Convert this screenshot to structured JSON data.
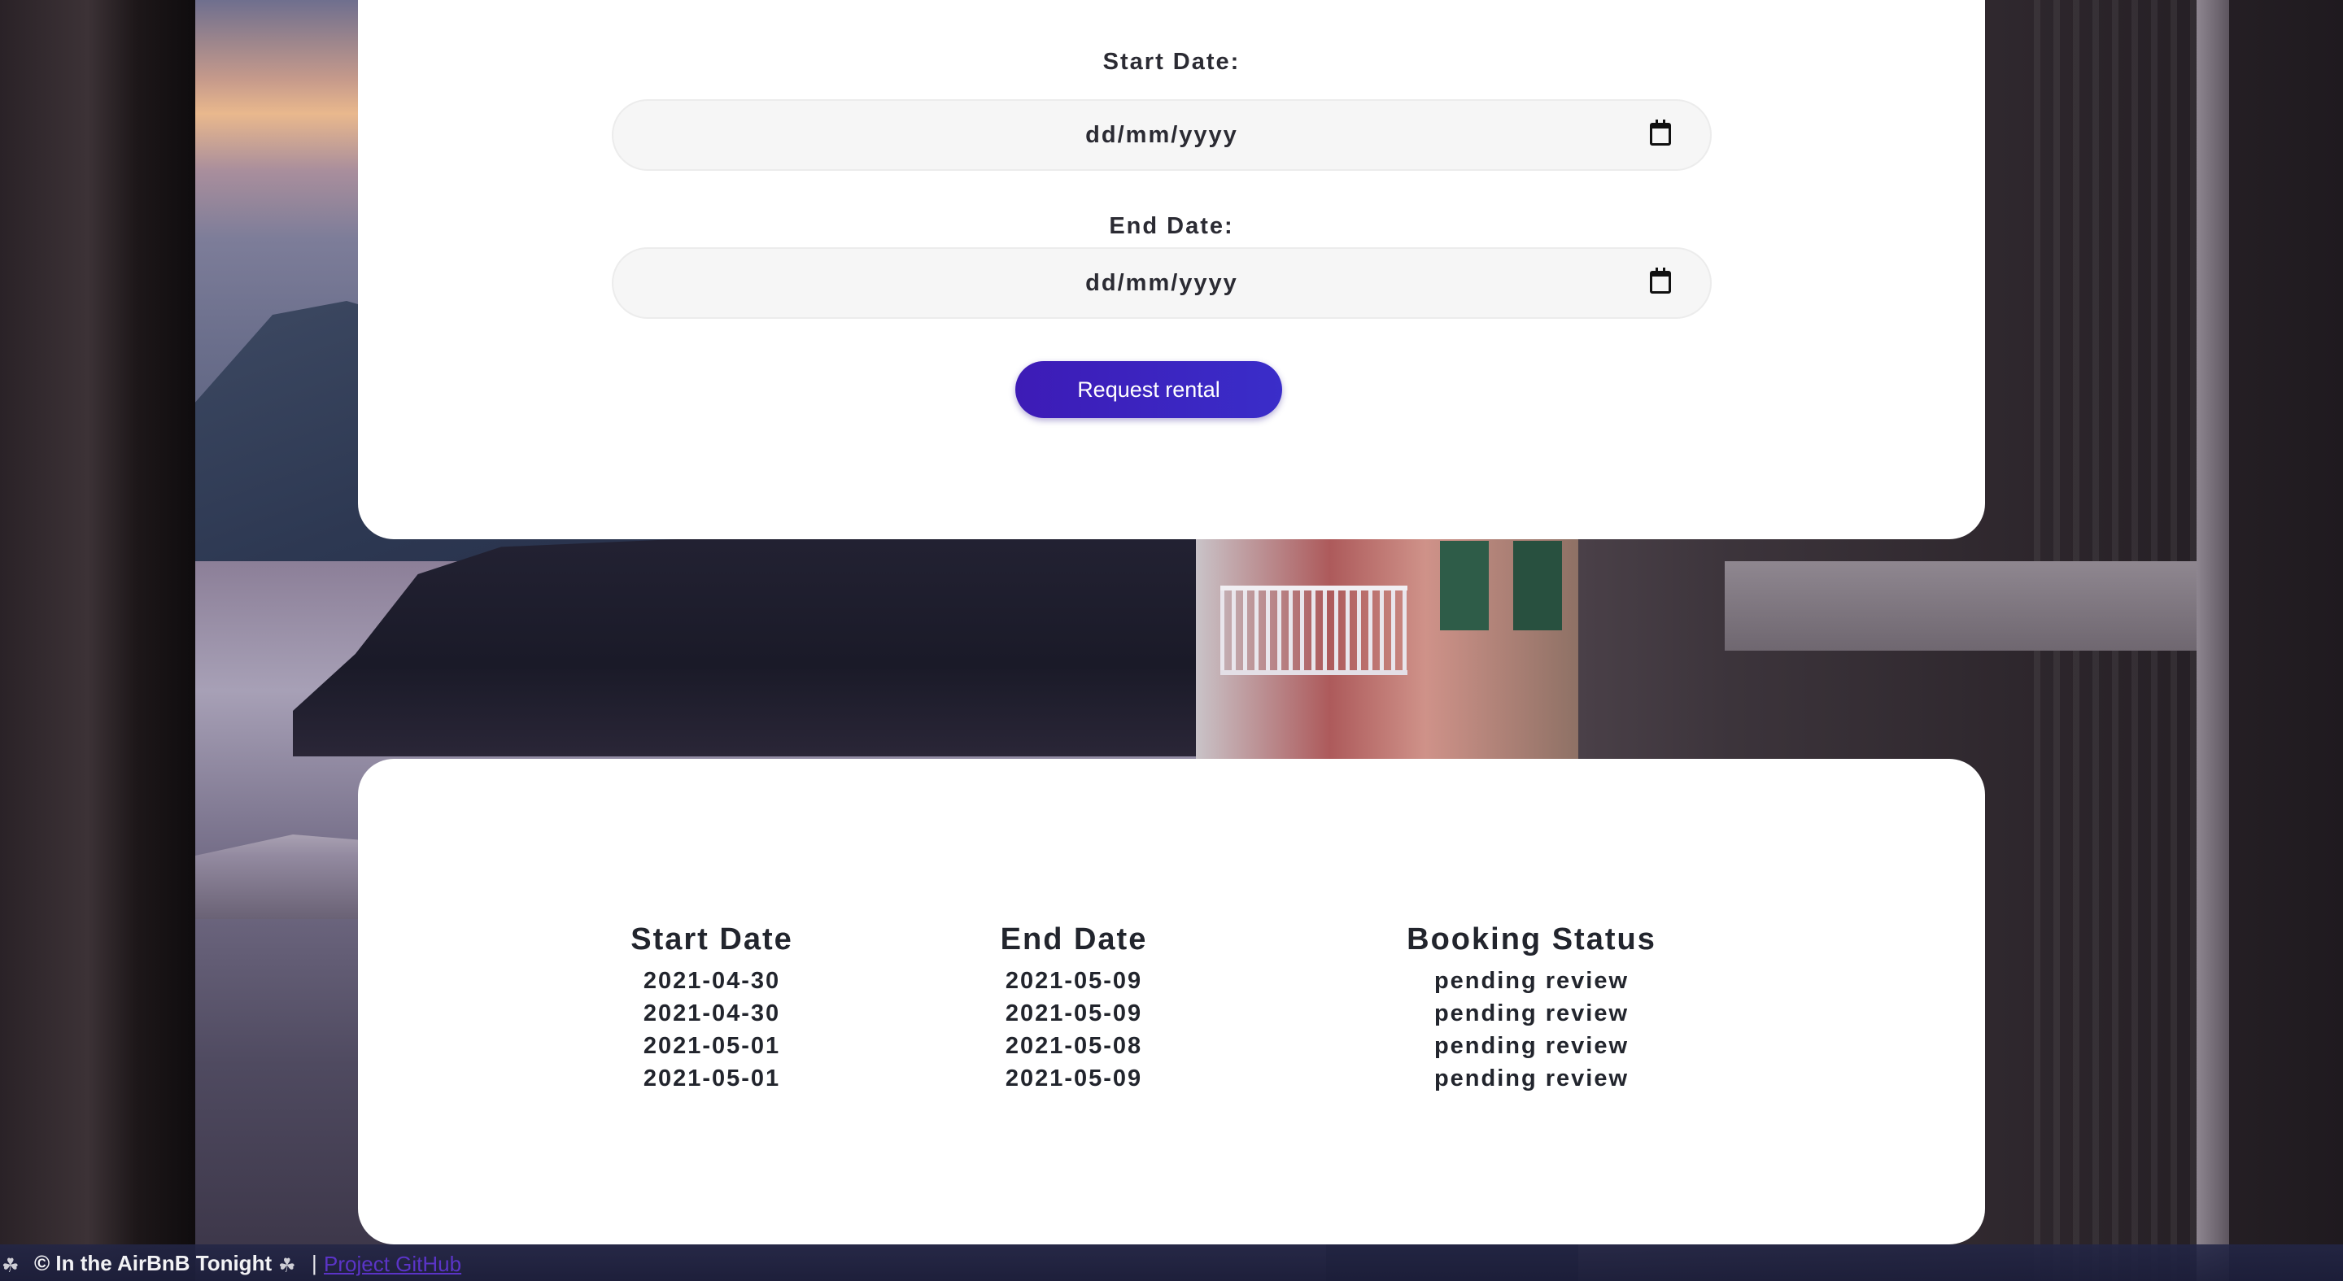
{
  "rental_form": {
    "start_label": "Start Date:",
    "start_placeholder": "dd/mm/yyyy",
    "end_label": "End Date:",
    "end_placeholder": "dd/mm/yyyy",
    "submit_label": "Request rental",
    "icons": {
      "date_picker": "calendar-icon"
    }
  },
  "bookings": {
    "headers": [
      "Start Date",
      "End Date",
      "Booking Status"
    ],
    "rows": [
      [
        "2021-04-30",
        "2021-05-09",
        "pending review"
      ],
      [
        "2021-04-30",
        "2021-05-09",
        "pending review"
      ],
      [
        "2021-05-01",
        "2021-05-08",
        "pending review"
      ],
      [
        "2021-05-01",
        "2021-05-09",
        "pending review"
      ]
    ]
  },
  "footer": {
    "copyright": "© In the AirBnB Tonight",
    "separator": "|",
    "github_link": "Project GitHub",
    "icons": [
      "leaf-icon",
      "leaf-icon"
    ]
  },
  "colors": {
    "accent": "#3d1bb6",
    "link": "#5b34c7",
    "card_bg": "#ffffff",
    "input_bg": "#f6f6f6",
    "footer_bg": "#232646"
  }
}
